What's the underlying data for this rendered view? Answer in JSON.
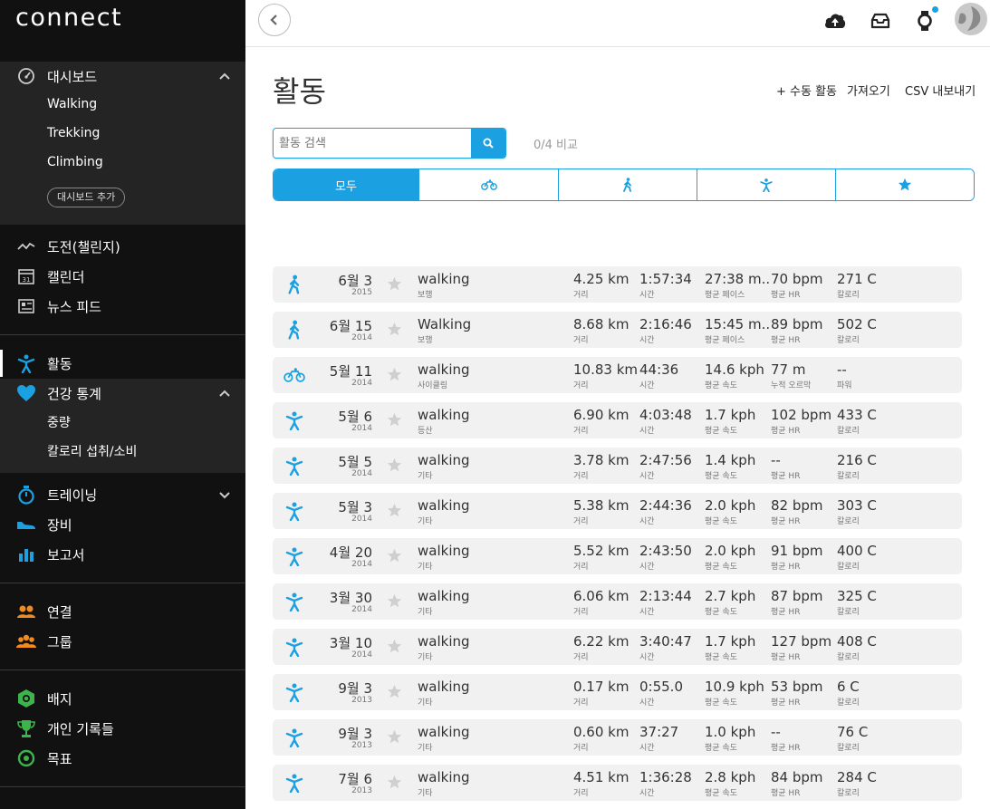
{
  "app": {
    "logo": "connect"
  },
  "sidebar": {
    "dashboard": {
      "label": "대시보드",
      "items": [
        "Walking",
        "Trekking",
        "Climbing"
      ],
      "add_label": "대시보드 추가"
    },
    "challenges": "도전(챌린지)",
    "calendar": "캘린더",
    "calendar_icon_day": "31",
    "news_feed": "뉴스 피드",
    "activities": "활동",
    "health": {
      "label": "건강 통계",
      "items": [
        "중량",
        "칼로리 섭취/소비"
      ]
    },
    "training": "트레이닝",
    "gear": "장비",
    "reports": "보고서",
    "connections": "연결",
    "groups": "그룹",
    "badges": "배지",
    "personal_records": "개인 기록들",
    "goals": "목표"
  },
  "page": {
    "title": "활동",
    "actions": {
      "manual": "+ 수동 활동",
      "import": "가져오기",
      "export": "CSV 내보내기"
    },
    "search": {
      "placeholder": "활동 검색"
    },
    "compare": "0/4 비교",
    "filters": {
      "all": "모두"
    }
  },
  "colors": {
    "accent": "#1ba0e1",
    "sidebar_bg": "#111111",
    "row_bg": "#f1f1f1"
  },
  "activities": [
    {
      "icon": "walking-icon",
      "date": "6월 3",
      "year": "2015",
      "name": "walking",
      "type": "보행",
      "v1": "4.25 km",
      "u1": "거리",
      "v2": "1:57:34",
      "u2": "시간",
      "v3": "27:38 m...",
      "u3": "평균 페이스",
      "v4": "70 bpm",
      "u4": "평균 HR",
      "v5": "271 C",
      "u5": "칼로리"
    },
    {
      "icon": "walking-icon",
      "date": "6월 15",
      "year": "2014",
      "name": "Walking",
      "type": "보행",
      "v1": "8.68 km",
      "u1": "거리",
      "v2": "2:16:46",
      "u2": "시간",
      "v3": "15:45 m...",
      "u3": "평균 페이스",
      "v4": "89 bpm",
      "u4": "평균 HR",
      "v5": "502 C",
      "u5": "칼로리"
    },
    {
      "icon": "cycling-icon",
      "date": "5월 11",
      "year": "2014",
      "name": "walking",
      "type": "사이클링",
      "v1": "10.83 km",
      "u1": "거리",
      "v2": "44:36",
      "u2": "시간",
      "v3": "14.6 kph",
      "u3": "평균 속도",
      "v4": "77 m",
      "u4": "누적 오르막",
      "v5": "--",
      "u5": "파워"
    },
    {
      "icon": "other-activity-icon",
      "date": "5월 6",
      "year": "2014",
      "name": "walking",
      "type": "등산",
      "v1": "6.90 km",
      "u1": "거리",
      "v2": "4:03:48",
      "u2": "시간",
      "v3": "1.7 kph",
      "u3": "평균 속도",
      "v4": "102 bpm",
      "u4": "평균 HR",
      "v5": "433 C",
      "u5": "칼로리"
    },
    {
      "icon": "other-activity-icon",
      "date": "5월 5",
      "year": "2014",
      "name": "walking",
      "type": "기타",
      "v1": "3.78 km",
      "u1": "거리",
      "v2": "2:47:56",
      "u2": "시간",
      "v3": "1.4 kph",
      "u3": "평균 속도",
      "v4": "--",
      "u4": "평균 HR",
      "v5": "216 C",
      "u5": "칼로리"
    },
    {
      "icon": "other-activity-icon",
      "date": "5월 3",
      "year": "2014",
      "name": "walking",
      "type": "기타",
      "v1": "5.38 km",
      "u1": "거리",
      "v2": "2:44:36",
      "u2": "시간",
      "v3": "2.0 kph",
      "u3": "평균 속도",
      "v4": "82 bpm",
      "u4": "평균 HR",
      "v5": "303 C",
      "u5": "칼로리"
    },
    {
      "icon": "other-activity-icon",
      "date": "4월 20",
      "year": "2014",
      "name": "walking",
      "type": "기타",
      "v1": "5.52 km",
      "u1": "거리",
      "v2": "2:43:50",
      "u2": "시간",
      "v3": "2.0 kph",
      "u3": "평균 속도",
      "v4": "91 bpm",
      "u4": "평균 HR",
      "v5": "400 C",
      "u5": "칼로리"
    },
    {
      "icon": "other-activity-icon",
      "date": "3월 30",
      "year": "2014",
      "name": "walking",
      "type": "기타",
      "v1": "6.06 km",
      "u1": "거리",
      "v2": "2:13:44",
      "u2": "시간",
      "v3": "2.7 kph",
      "u3": "평균 속도",
      "v4": "87 bpm",
      "u4": "평균 HR",
      "v5": "325 C",
      "u5": "칼로리"
    },
    {
      "icon": "other-activity-icon",
      "date": "3월 10",
      "year": "2014",
      "name": "walking",
      "type": "기타",
      "v1": "6.22 km",
      "u1": "거리",
      "v2": "3:40:47",
      "u2": "시간",
      "v3": "1.7 kph",
      "u3": "평균 속도",
      "v4": "127 bpm",
      "u4": "평균 HR",
      "v5": "408 C",
      "u5": "칼로리"
    },
    {
      "icon": "other-activity-icon",
      "date": "9월 3",
      "year": "2013",
      "name": "walking",
      "type": "기타",
      "v1": "0.17 km",
      "u1": "거리",
      "v2": "0:55.0",
      "u2": "시간",
      "v3": "10.9 kph",
      "u3": "평균 속도",
      "v4": "53 bpm",
      "u4": "평균 HR",
      "v5": "6 C",
      "u5": "칼로리"
    },
    {
      "icon": "other-activity-icon",
      "date": "9월 3",
      "year": "2013",
      "name": "walking",
      "type": "기타",
      "v1": "0.60 km",
      "u1": "거리",
      "v2": "37:27",
      "u2": "시간",
      "v3": "1.0 kph",
      "u3": "평균 속도",
      "v4": "--",
      "u4": "평균 HR",
      "v5": "76 C",
      "u5": "칼로리"
    },
    {
      "icon": "other-activity-icon",
      "date": "7월 6",
      "year": "2013",
      "name": "walking",
      "type": "기타",
      "v1": "4.51 km",
      "u1": "거리",
      "v2": "1:36:28",
      "u2": "시간",
      "v3": "2.8 kph",
      "u3": "평균 속도",
      "v4": "84 bpm",
      "u4": "평균 HR",
      "v5": "284 C",
      "u5": "칼로리"
    }
  ]
}
